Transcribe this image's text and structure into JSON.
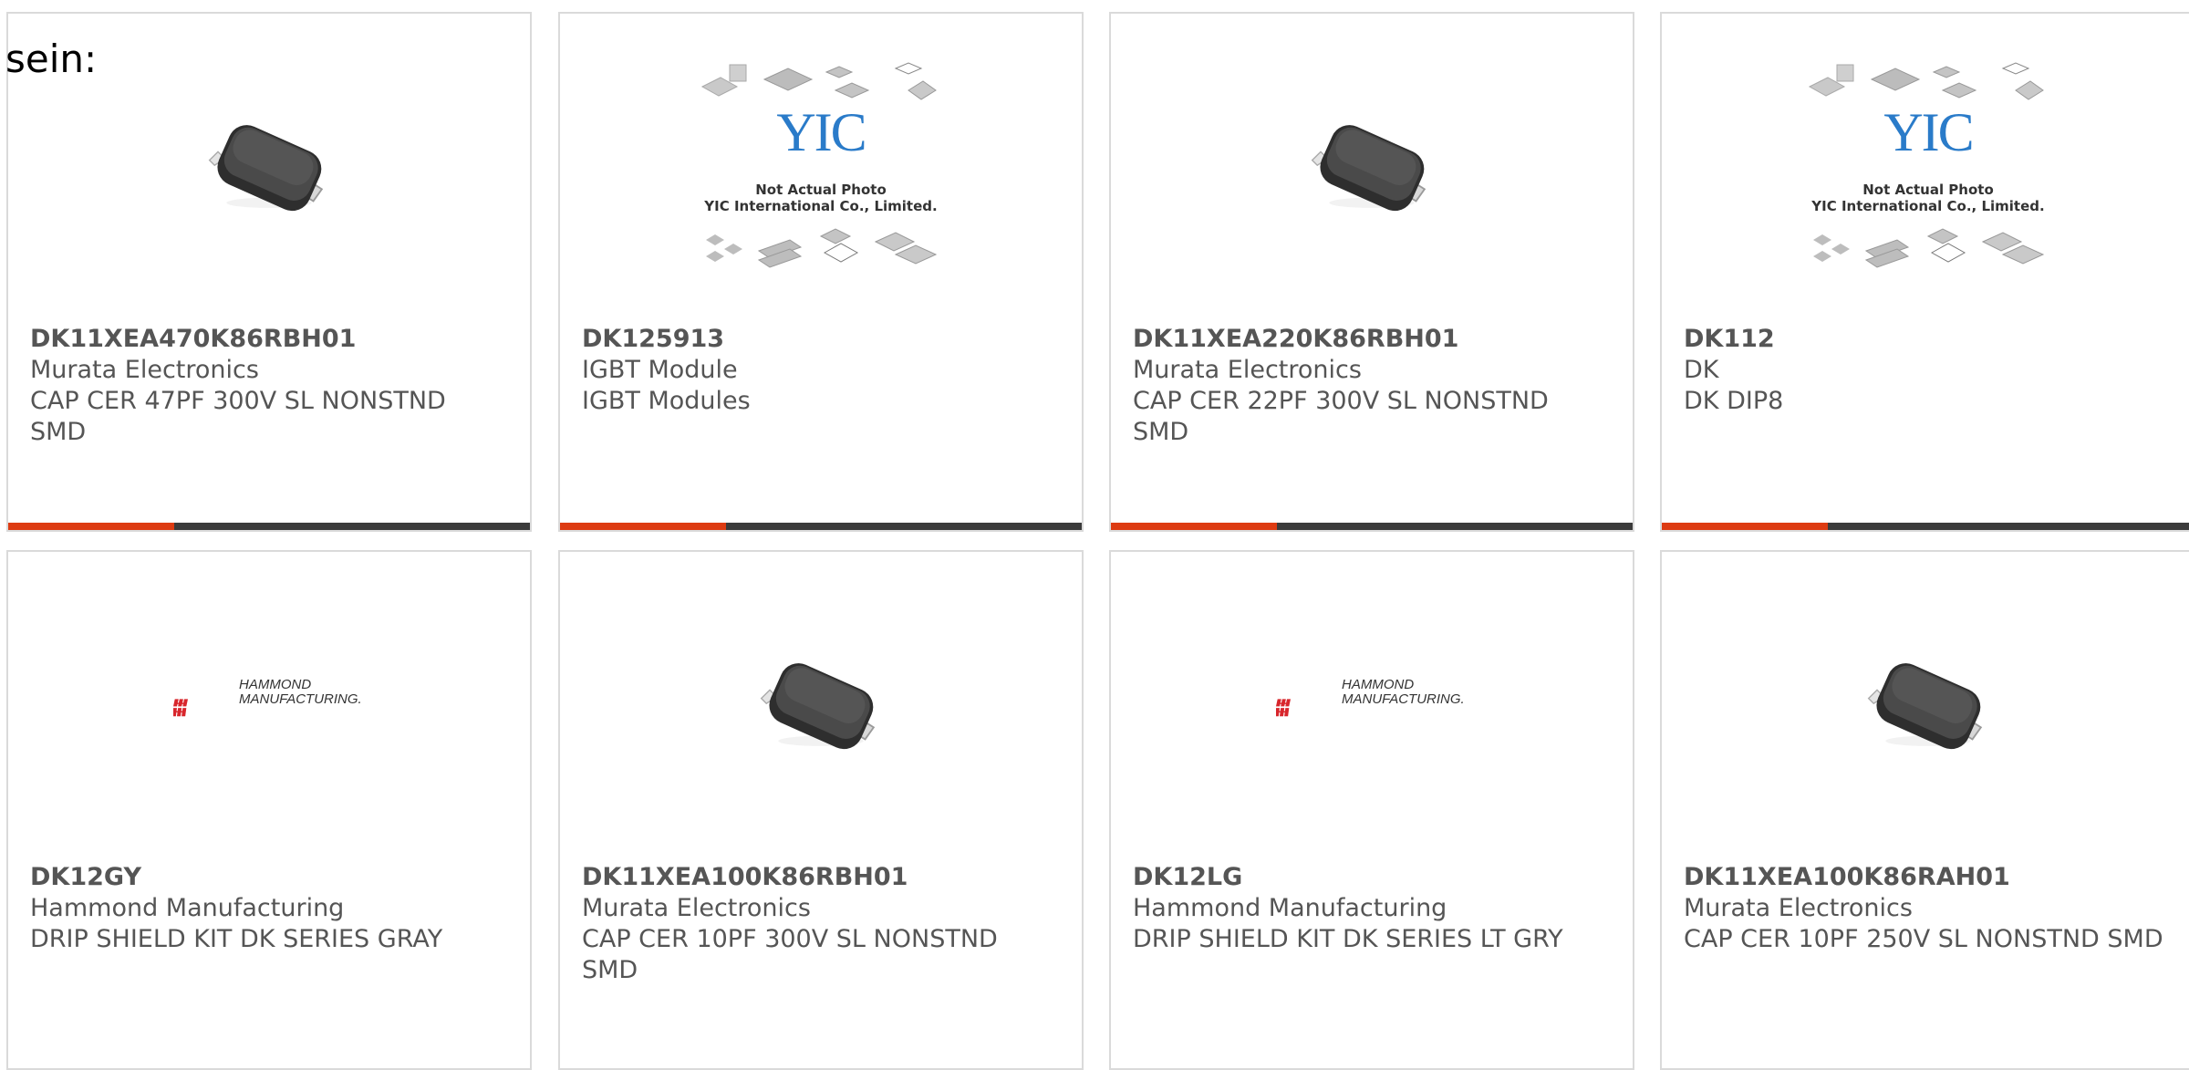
{
  "intro_text": "sein:",
  "colors": {
    "accent": "#dd3b12",
    "bar": "#3b3b3b",
    "border": "#dadada",
    "text": "#555555"
  },
  "products": [
    {
      "part_number": "DK11XEA470K86RBH01",
      "manufacturer": "Murata Electronics",
      "description": "CAP CER 47PF 300V SL NONSTND SMD",
      "image": "ceramic-chip-image"
    },
    {
      "part_number": "DK125913",
      "manufacturer": "IGBT Module",
      "description": "IGBT Modules",
      "image": "placeholder-photo-image",
      "placeholder_logo": "YIC",
      "placeholder_line1": "Not Actual Photo",
      "placeholder_line2": "YIC International Co., Limited."
    },
    {
      "part_number": "DK11XEA220K86RBH01",
      "manufacturer": "Murata Electronics",
      "description": "CAP CER 22PF 300V SL NONSTND SMD",
      "image": "ceramic-chip-image"
    },
    {
      "part_number": "DK112",
      "manufacturer": "DK",
      "description": "DK DIP8",
      "image": "placeholder-photo-image",
      "placeholder_logo": "YIC",
      "placeholder_line1": "Not Actual Photo",
      "placeholder_line2": "YIC International Co., Limited."
    },
    {
      "part_number": "DK12GY",
      "manufacturer": "Hammond Manufacturing",
      "description": "DRIP SHIELD KIT DK SERIES GRAY",
      "image": "hammond-logo-image",
      "logo_line1": "HAMMOND",
      "logo_line2": "MANUFACTURING."
    },
    {
      "part_number": "DK11XEA100K86RBH01",
      "manufacturer": "Murata Electronics",
      "description": "CAP CER 10PF 300V SL NONSTND SMD",
      "image": "ceramic-chip-image"
    },
    {
      "part_number": "DK12LG",
      "manufacturer": "Hammond Manufacturing",
      "description": "DRIP SHIELD KIT DK SERIES LT GRY",
      "image": "hammond-logo-image",
      "logo_line1": "HAMMOND",
      "logo_line2": "MANUFACTURING."
    },
    {
      "part_number": "DK11XEA100K86RAH01",
      "manufacturer": "Murata Electronics",
      "description": "CAP CER 10PF 250V SL NONSTND SMD",
      "image": "ceramic-chip-image"
    }
  ]
}
